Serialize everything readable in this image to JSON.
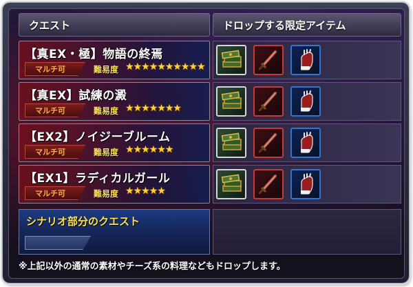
{
  "header": {
    "quest_label": "クエスト",
    "drop_label": "ドロップする限定アイテム"
  },
  "quests": [
    {
      "title": "【真EX・極】物語の終焉",
      "multi_label": "マルチ可",
      "difficulty_label": "難易度",
      "stars": "★★★★★★★★★★",
      "difficulty_stars": 10
    },
    {
      "title": "【真EX】試練の澱",
      "multi_label": "マルチ可",
      "difficulty_label": "難易度",
      "stars": "★★★★★★★",
      "difficulty_stars": 7
    },
    {
      "title": "【EX2】ノイジーブルーム",
      "multi_label": "マルチ可",
      "difficulty_label": "難易度",
      "stars": "★★★★★★",
      "difficulty_stars": 6
    },
    {
      "title": "【EX1】ラディカルガール",
      "multi_label": "マルチ可",
      "difficulty_label": "難易度",
      "stars": "★★★★★",
      "difficulty_stars": 5
    }
  ],
  "drop_icons": [
    "book-icon",
    "sword-icon",
    "glove-icon"
  ],
  "scenario": {
    "title": "シナリオ部分のクエスト"
  },
  "note": "※上記以外の通常の素材やチーズ系の料理などもドロップします。",
  "colors": {
    "star": "#ffd23a",
    "multi_text": "#ffb24c",
    "scenario_title": "#ffe04a",
    "book_frame": "#d7d7d7",
    "sword_frame": "#c83a3a",
    "glove_frame": "#2e76d6"
  }
}
